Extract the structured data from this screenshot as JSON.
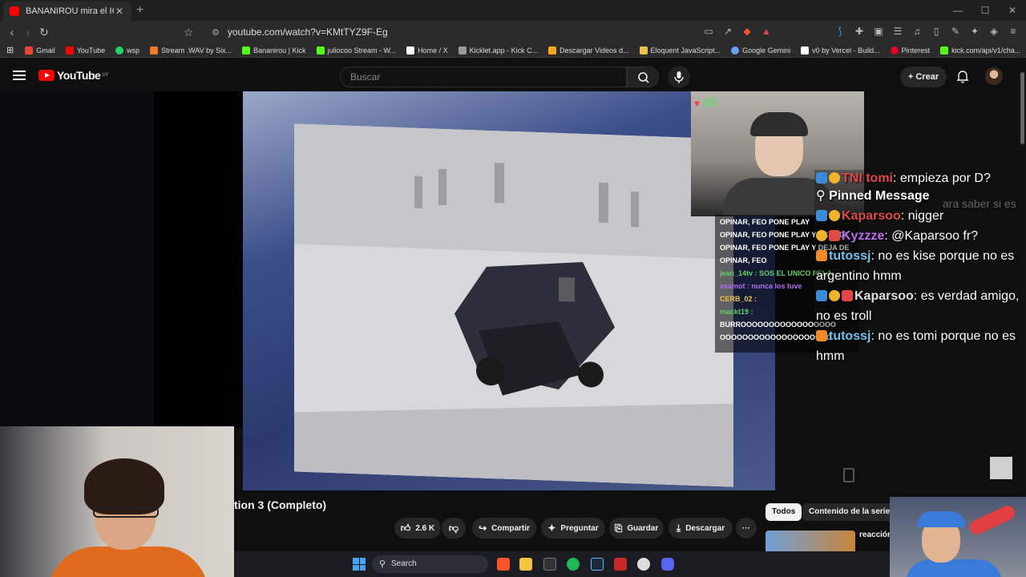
{
  "browser": {
    "tab_title": "BANANIROU mira el ICEBERG",
    "tab_close": "✕",
    "new_tab": "+",
    "url": "youtube.com/watch?v=KMtTYZ9F-Eg",
    "bookmarks": [
      {
        "label": "Gmail",
        "color": "#ea4335"
      },
      {
        "label": "YouTube",
        "color": "#ff0000"
      },
      {
        "label": "wsp",
        "color": "#25d366"
      },
      {
        "label": "Stream .WAV by Six...",
        "color": "#f07a2a"
      },
      {
        "label": "Bananirou | Kick",
        "color": "#53fc18"
      },
      {
        "label": "juliocoo Stream - W...",
        "color": "#53fc18"
      },
      {
        "label": "Home / X",
        "color": "#ffffff"
      },
      {
        "label": "Kicklet.app - Kick C...",
        "color": "#9a9a9a"
      },
      {
        "label": "Descargar Videos d...",
        "color": "#f5a623"
      },
      {
        "label": "Eloquent JavaScript...",
        "color": "#e8c34a"
      },
      {
        "label": "Google Gemini",
        "color": "#6aa0f5"
      },
      {
        "label": "v0 by Vercel - Build...",
        "color": "#ffffff"
      },
      {
        "label": "Pinterest",
        "color": "#e60023"
      },
      {
        "label": "kick.com/api/v1/cha...",
        "color": "#53fc18"
      }
    ]
  },
  "youtube": {
    "logo_text": "YouTube",
    "logo_region": "UY",
    "search_placeholder": "Buscar",
    "create_label": "Crear"
  },
  "stream_overlay": {
    "viewer_count": "68",
    "small_chat": [
      {
        "text": "OPINAR, FEO PONE PLAY",
        "style": ""
      },
      {
        "text": "OPINAR, FEO PONE PLAY Y DEJA DE",
        "style": ""
      },
      {
        "text": "OPINAR, FEO PONE PLAY Y DEJA DE",
        "style": ""
      },
      {
        "text": "OPINAR, FEO",
        "style": ""
      },
      {
        "text": "jean_14tv : SOS EL UNICO PELA",
        "style": "g"
      },
      {
        "text": "esamot : nunca los tuve",
        "style": "p"
      },
      {
        "text": "CERB_02 :",
        "style": "y"
      },
      {
        "text": "mackt19 :",
        "style": "g"
      },
      {
        "text": "BURROOOOOOOOOOOOOOOOO",
        "style": ""
      },
      {
        "text": "OOOOOOOOOOOOOOOOOOOO",
        "style": ""
      }
    ],
    "big_chat": {
      "top_line": {
        "name": "TNI tomi",
        "text": ": empieza por D?"
      },
      "pinned_label": "Pinned Message",
      "pinned_tail": "ara saber si es",
      "messages": [
        {
          "name": "Kaparsoo",
          "text": ": nigger"
        },
        {
          "name": "Kyzzze",
          "text": ": @Kaparsoo fr?"
        },
        {
          "name": "tutossj",
          "text": ": no es kise porque no es argentino hmm"
        },
        {
          "name": "Kaparsoo",
          "text": ": es verdad amigo, no es troll"
        },
        {
          "name": "tutossj",
          "text": ": no es tomi porque no es hmm"
        }
      ]
    }
  },
  "video": {
    "title_partial": "tion 3 (Completo)",
    "likes": "2.6 K",
    "share_label": "Compartir",
    "ask_label": "Preguntar",
    "save_label": "Guardar",
    "download_label": "Descargar",
    "more_label": "···"
  },
  "sidebar": {
    "chip_all": "Todos",
    "chip_series": "Contenido de la serie",
    "related_title": "reacción"
  },
  "taskbar": {
    "search_label": "Search"
  }
}
